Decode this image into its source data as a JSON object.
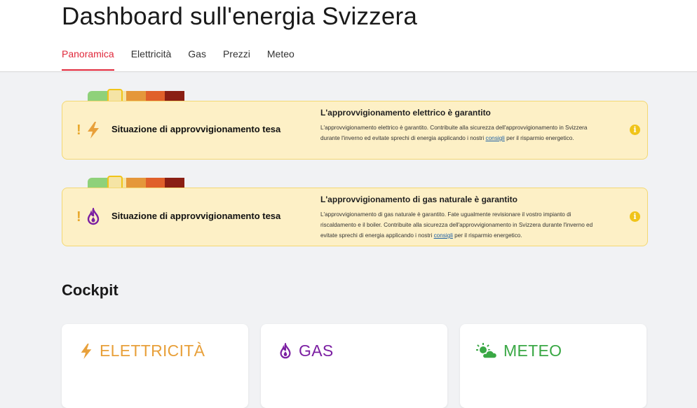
{
  "header": {
    "title": "Dashboard sull'energia Svizzera",
    "tabs": [
      {
        "label": "Panoramica",
        "active": true
      },
      {
        "label": "Elettricità",
        "active": false
      },
      {
        "label": "Gas",
        "active": false
      },
      {
        "label": "Prezzi",
        "active": false
      },
      {
        "label": "Meteo",
        "active": false
      }
    ]
  },
  "gauge_colors": [
    "#8fd17a",
    "#f5e4a5",
    "#e5973a",
    "#e0602a",
    "#8a1f14"
  ],
  "colors": {
    "accent": "#e0283b",
    "warning": "#f0c419",
    "electricity": "#e8a03a",
    "gas": "#7b1fa2",
    "weather": "#3aa845"
  },
  "alerts": [
    {
      "icon": "lightning-icon",
      "status": "Situazione di approvvigionamento tesa",
      "heading": "L'approvvigionamento elettrico è garantito",
      "body_before": "L'approvvigionamento elettrico è garantito. Contribuite alla sicurezza dell'approvvigionamento in Svizzera durante l'inverno ed evitate sprechi di energia applicando i nostri ",
      "link": "consigli",
      "body_after": " per il risparmio energetico."
    },
    {
      "icon": "flame-icon",
      "status": "Situazione di approvvigionamento tesa",
      "heading": "L'approvvigionamento di gas naturale è garantito",
      "body_before": "L'approvvigionamento di gas naturale è garantito. Fate ugualmente revisionare il vostro impianto di riscaldamento e il boiler. Contribuite alla sicurezza dell'approvvigionamento in Svizzera durante l'inverno ed evitate sprechi di energia applicando i nostri ",
      "link": "consigli",
      "body_after": " per il risparmio energetico."
    }
  ],
  "cockpit": {
    "title": "Cockpit",
    "cards": [
      {
        "title": "ELETTRICITÀ",
        "icon": "lightning-icon"
      },
      {
        "title": "GAS",
        "icon": "flame-icon"
      },
      {
        "title": "METEO",
        "icon": "sun-cloud-icon"
      }
    ]
  }
}
